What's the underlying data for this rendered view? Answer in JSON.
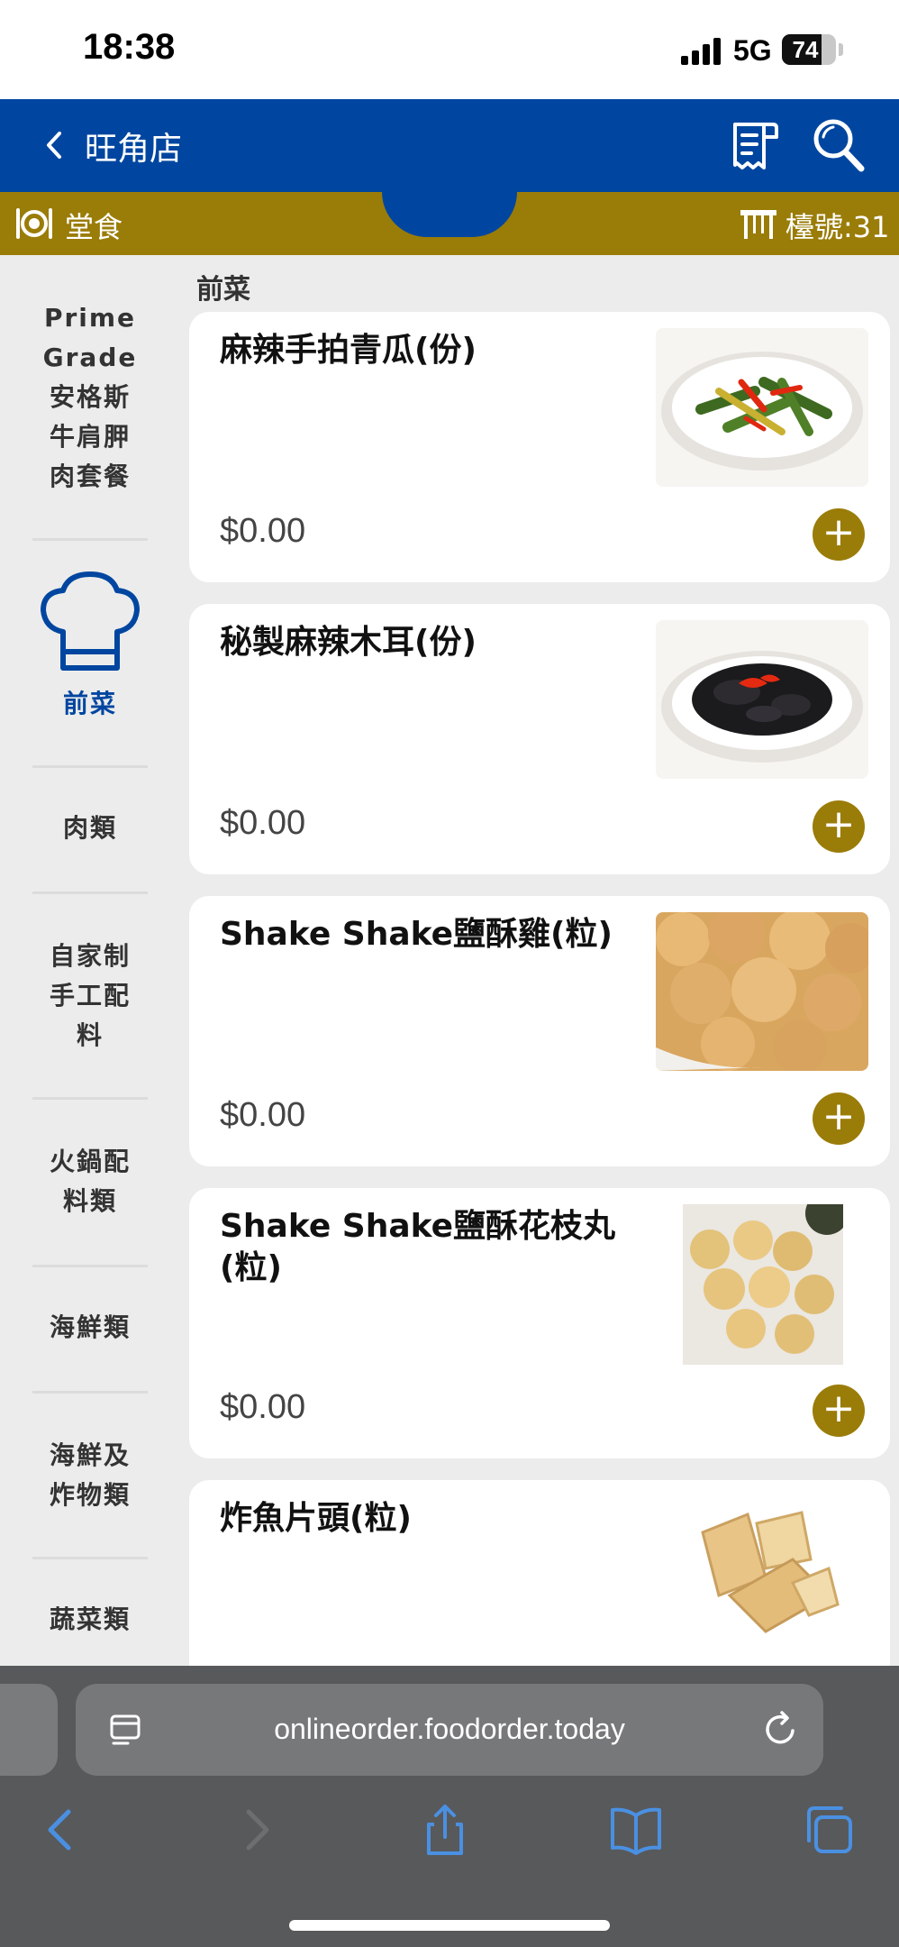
{
  "status_bar": {
    "time": "18:38",
    "network": "5G",
    "battery": "74",
    "battery_level": 0.74
  },
  "header": {
    "store_name": "旺角店"
  },
  "mode_bar": {
    "dine_in_label": "堂食",
    "table_label": "檯號:31"
  },
  "sidebar": {
    "categories": [
      {
        "label": "Prime Grade 安格斯牛肩胛肉套餐",
        "lines": [
          "Prime",
          "Grade",
          "安格斯",
          "牛肩胛",
          "肉套餐"
        ]
      },
      {
        "label": "前菜",
        "active": true,
        "icon": "chef-hat-icon"
      },
      {
        "label": "肉類"
      },
      {
        "label": "自家制手工配料",
        "lines": [
          "自家制",
          "手工配",
          "料"
        ]
      },
      {
        "label": "火鍋配料類",
        "lines": [
          "火鍋配",
          "料類"
        ]
      },
      {
        "label": "海鮮類"
      },
      {
        "label": "海鮮及炸物類",
        "lines": [
          "海鮮及",
          "炸物類"
        ]
      },
      {
        "label": "蔬菜類"
      }
    ]
  },
  "content": {
    "section_title": "前菜",
    "items": [
      {
        "name": "麻辣手拍青瓜(份)",
        "price": "$0.00",
        "image": "cucumber-salad-image",
        "add_label": "+"
      },
      {
        "name": "秘製麻辣木耳(份)",
        "price": "$0.00",
        "image": "wood-ear-fungus-image",
        "add_label": "+"
      },
      {
        "name": "Shake Shake鹽酥雞(粒)",
        "price": "$0.00",
        "image": "popcorn-chicken-image",
        "add_label": "+"
      },
      {
        "name": "Shake Shake鹽酥花枝丸(粒)",
        "price": "$0.00",
        "image": "squid-ball-image",
        "add_label": "+"
      },
      {
        "name": "炸魚片頭(粒)",
        "price": "",
        "image": "fried-fish-cake-image",
        "add_label": "+"
      }
    ]
  },
  "browser": {
    "url": "onlineorder.foodorder.today"
  },
  "colors": {
    "primary": "#0046a0",
    "accent": "#9a7c08",
    "background": "#ececec",
    "browser_chrome": "#58595b",
    "ios_blue": "#4a90e2"
  }
}
